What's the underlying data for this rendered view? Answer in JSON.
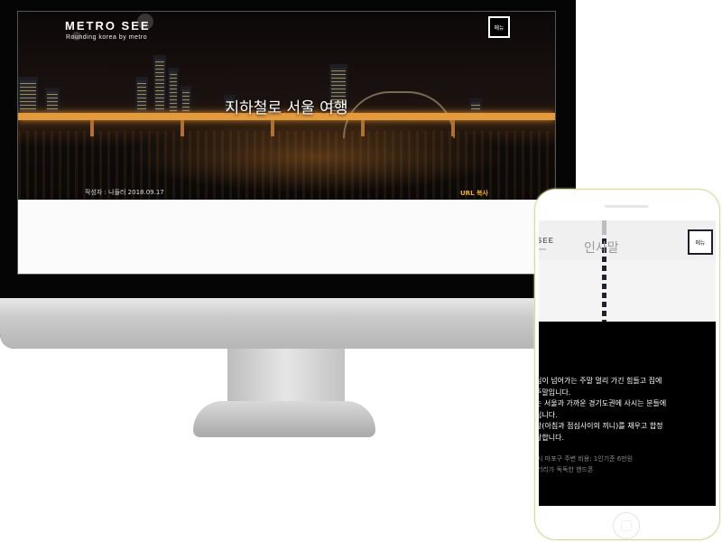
{
  "desktop": {
    "brand_title": "METRO SEE",
    "brand_subtitle": "Rounding korea by metro",
    "menu_label": "메뉴",
    "hero_title": "지하철로 서울 여행",
    "author_line": "작성자 : 나들러   2018.09.17",
    "url_copy": "URL 복사"
  },
  "mobile": {
    "brand_title": "SEE",
    "brand_subtitle": "metro",
    "section_heading": "인사말",
    "menu_label": "메뉴",
    "paragraph_lines": [
      "심이 넘어가는 주말 멀리 가긴 힘들고 집에",
      " 주말입니다.",
      "는 서울과 가까운 경기도권에 사시는 분들에",
      "립니다.",
      "장(아침과 점심사이의 끼니)를 채우고 합정",
      "발합니다."
    ],
    "meta_lines": [
      "시 마포구 주변   비용: 1인기준 6만원",
      "터리가 독독한 핸드폰"
    ]
  },
  "colors": {
    "accent_url": "#f0b020",
    "dark": "#000000",
    "phone_dash": "#20232e"
  }
}
